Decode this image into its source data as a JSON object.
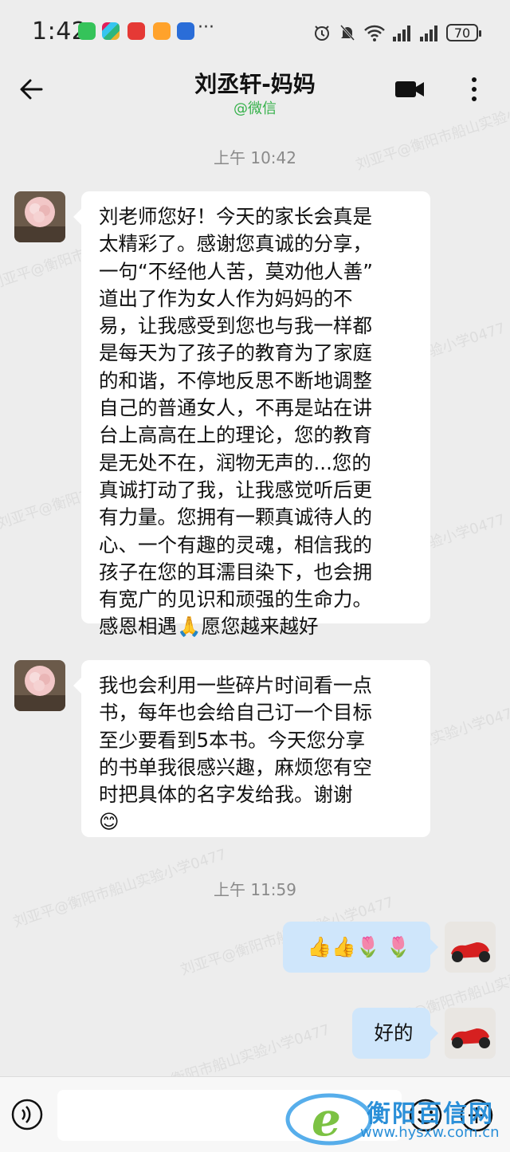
{
  "status_bar": {
    "time": "1:42",
    "more": "···",
    "battery": "70"
  },
  "header": {
    "title": "刘丞轩-妈妈",
    "subtitle": "@微信"
  },
  "messages": [
    {
      "type": "timestamp",
      "text": "上午 10:42"
    },
    {
      "type": "incoming",
      "text": "刘老师您好！今天的家长会真是\n太精彩了。感谢您真诚的分享，\n一句“不经他人苦，莫劝他人善”\n道出了作为女人作为妈妈的不\n易，让我感受到您也与我一样都\n是每天为了孩子的教育为了家庭\n的和谐，不停地反思不断地调整\n自己的普通女人，不再是站在讲\n台上高高在上的理论，您的教育\n是无处不在，润物无声的...您的\n真诚打动了我，让我感觉听后更\n有力量。您拥有一颗真诚待人的\n心、一个有趣的灵魂，相信我的\n孩子在您的耳濡目染下，也会拥\n有宽广的见识和顽强的生命力。\n感恩相遇🙏愿您越来越好"
    },
    {
      "type": "incoming",
      "text": "我也会利用一些碎片时间看一点\n书，每年也会给自己订一个目标\n至少要看到5本书。今天您分享\n的书单我很感兴趣，麻烦您有空\n时把具体的名字发给我。谢谢\n😊"
    },
    {
      "type": "timestamp",
      "text": "上午 11:59"
    },
    {
      "type": "outgoing",
      "text": "👍👍🌷 🌷"
    },
    {
      "type": "outgoing",
      "text": "好的"
    }
  ],
  "watermark": "刘亚平@衡阳市船山实验小学0477",
  "site": {
    "name": "衡阳百信网",
    "url": "www.hysxw.com.cn"
  },
  "colors": {
    "chat_background": "#ededed",
    "incoming_bubble": "#ffffff",
    "outgoing_bubble": "#cfe6fb",
    "subtitle_green": "#36b14b",
    "site_blue": "#2a8fd8"
  },
  "icons": [
    "back-arrow-icon",
    "video-call-icon",
    "more-vertical-icon",
    "voice-icon",
    "emoji-icon",
    "plus-icon",
    "notification-off-icon",
    "wifi-icon",
    "signal-icon",
    "battery-icon"
  ]
}
